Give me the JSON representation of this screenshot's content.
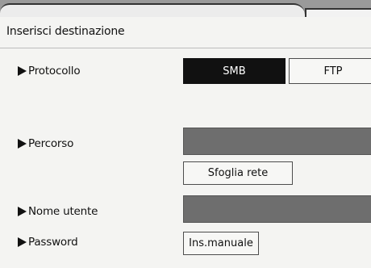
{
  "header": {
    "title": "Inserisci destinazione"
  },
  "protocol": {
    "label": "Protocollo",
    "options": [
      "SMB",
      "FTP"
    ],
    "selected": "SMB"
  },
  "path": {
    "label": "Percorso",
    "value": "",
    "browse_label": "Sfoglia rete"
  },
  "username": {
    "label": "Nome utente",
    "value": ""
  },
  "password": {
    "label": "Password",
    "manual_label": "Ins.manuale"
  },
  "colors": {
    "selected_bg": "#111111",
    "field_bg": "#6e6e6e",
    "page_bg": "#f4f4f2"
  }
}
